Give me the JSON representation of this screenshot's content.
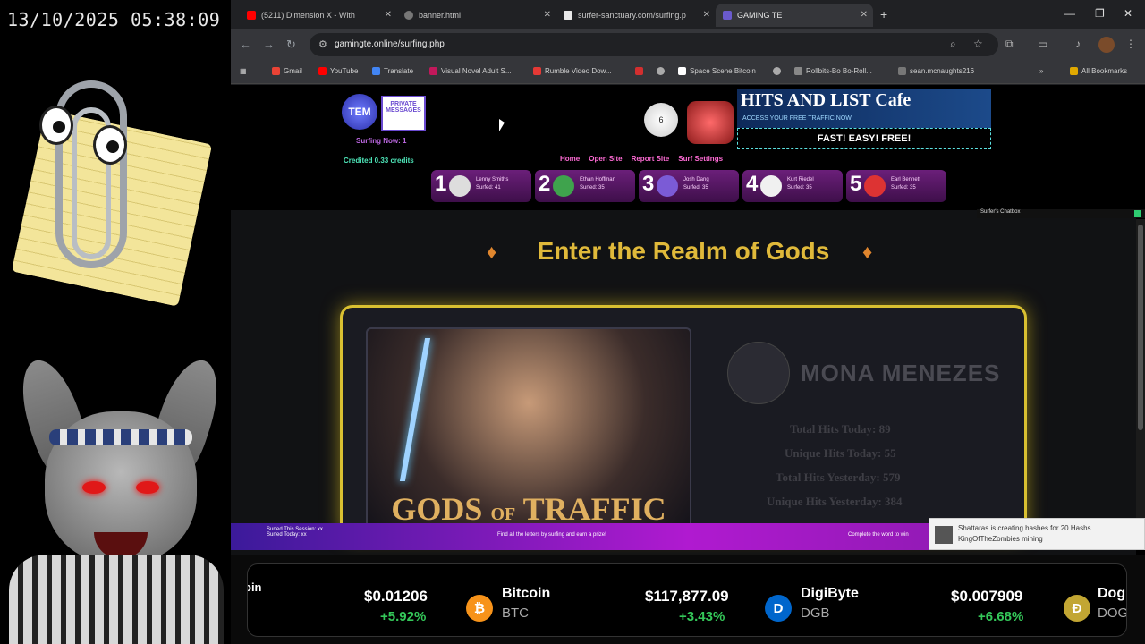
{
  "overlay": {
    "clock": "13/10/2025 05:38:09"
  },
  "browser": {
    "tabs": [
      {
        "label": "(5211) Dimension X - With",
        "icon": "youtube-icon"
      },
      {
        "label": "banner.html",
        "icon": "globe-icon"
      },
      {
        "label": "surfer-sanctuary.com/surfing.p",
        "icon": "site-icon"
      },
      {
        "label": "GAMING TE",
        "icon": "site-icon"
      }
    ],
    "url": "gamingte.online/surfing.php",
    "bookmarks": [
      "Gmail",
      "YouTube",
      "Translate",
      "Visual Novel Adult S...",
      "Rumble Video Dow...",
      "",
      "",
      "Space Scene Bitcoin",
      "",
      "Rollbits-Bo Bo-Roll...",
      "sean.mcnaughts216"
    ],
    "all_bookmarks": "All Bookmarks"
  },
  "page": {
    "tem_logo": "TEM",
    "private_messages": "PRIVATE MESSAGES",
    "surfing_now": "Surfing Now: 1",
    "credited": "Credited 0.33 credits",
    "ball_number": "6",
    "hits_title": "HITS AND LIST Cafe",
    "hits_sub": "ACCESS YOUR FREE TRAFFIC NOW",
    "fast_banner": "FAST! EASY! FREE!",
    "menu": [
      "Home",
      "Open Site",
      "Report Site",
      "Surf Settings"
    ],
    "top_surfers": [
      {
        "rank": "1",
        "name": "Lenny Smiths",
        "score": "Surfed: 41"
      },
      {
        "rank": "2",
        "name": "Ethan Hoffman",
        "score": "Surfed: 35"
      },
      {
        "rank": "3",
        "name": "Josh Dang",
        "score": "Surfed: 35"
      },
      {
        "rank": "4",
        "name": "Kurt Riedel",
        "score": "Surfed: 35"
      },
      {
        "rank": "5",
        "name": "Earl Bennett",
        "score": "Surfed: 35"
      }
    ],
    "chat_label": "Surfer's Chatbox",
    "realm_title": "Enter the Realm of Gods",
    "gods_title_1": "GODS",
    "gods_title_of": "OF",
    "gods_title_2": "TRAFFIC",
    "member_name": "MONA MENEZES",
    "stats": [
      "Total Hits Today: 89",
      "Unique Hits Today: 55",
      "Total Hits Yesterday: 579",
      "Unique Hits Yesterday: 384"
    ],
    "footer_left": "Surfed This Session: xx Surfed Today: xx",
    "footer_mid": "Find all the letters by surfing and earn a prize!",
    "footer_right": "Complete the word to win",
    "toast": "Shattaras is creating hashes for 20 Hashs. KingOfTheZombies mining"
  },
  "ticker": [
    {
      "name": "oin",
      "symbol": "",
      "price": "$0.01206",
      "change": "+5.92%"
    },
    {
      "name": "Bitcoin",
      "symbol": "BTC",
      "price": "$117,877.09",
      "change": "+3.43%"
    },
    {
      "name": "DigiByte",
      "symbol": "DGB",
      "price": "$0.007909",
      "change": "+6.68%"
    },
    {
      "name": "Dog",
      "symbol": "DOG",
      "price": "",
      "change": ""
    }
  ],
  "colors": {
    "accent_gold": "#e0b93a",
    "menu_pink": "#ff6bd5",
    "positive_green": "#34c759",
    "footer_purple": "#b01ad0"
  }
}
